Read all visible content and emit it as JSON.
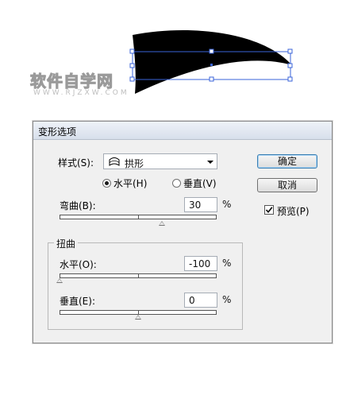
{
  "watermark": {
    "main": "软件自学网",
    "sub": "WWW.RJZXW.COM"
  },
  "dialog": {
    "title": "变形选项",
    "style_label": "样式(S):",
    "style_value": "拱形",
    "style_icon": "arch-warp-icon",
    "horizontal_radio": "水平(H)",
    "vertical_radio": "垂直(V)",
    "orientation_selected": "水平(H)",
    "bend_label": "弯曲(B):",
    "bend_value": "30",
    "bend_pct": "%",
    "distortion_group": "扭曲",
    "horiz_label": "水平(O):",
    "horiz_value": "-100",
    "horiz_pct": "%",
    "vert_label": "垂直(E):",
    "vert_value": "0",
    "vert_pct": "%",
    "ok_button": "确定",
    "cancel_button": "取消",
    "preview_label": "预览(P)",
    "preview_checked": true
  },
  "sliders": {
    "bend": 30,
    "horizontal": -100,
    "vertical": 0
  },
  "colors": {
    "dialog_bg": "#f0f0f0",
    "default_button_border": "#3c7fb1",
    "shape_fill": "#000000",
    "selection": "#3a63d8"
  }
}
